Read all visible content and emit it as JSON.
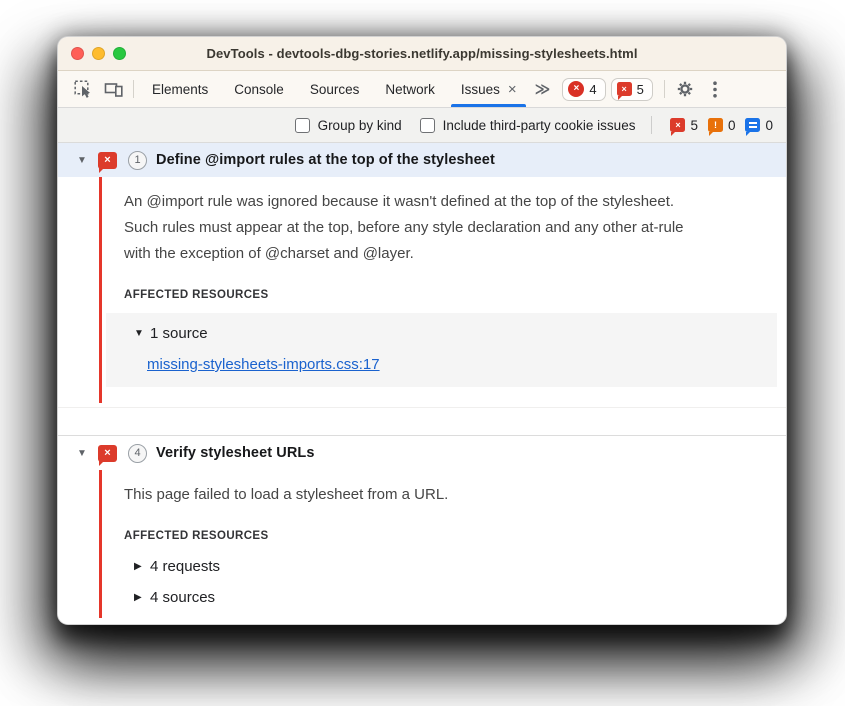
{
  "window": {
    "title": "DevTools - devtools-dbg-stories.netlify.app/missing-stylesheets.html"
  },
  "tabbar": {
    "tabs": [
      "Elements",
      "Console",
      "Sources",
      "Network"
    ],
    "issues_tab_label": "Issues",
    "error_count": "4",
    "issue_count": "5"
  },
  "filterbar": {
    "group_by_kind_label": "Group by kind",
    "third_party_label": "Include third-party cookie issues",
    "page_error_count": "5",
    "warning_count": "0",
    "info_count": "0"
  },
  "issues": [
    {
      "count": "1",
      "title": "Define @import rules at the top of the stylesheet",
      "description": "An @import rule was ignored because it wasn't defined at the top of the stylesheet. Such rules must appear at the top, before any style declaration and any other at-rule with the exception of @charset and @layer.",
      "affected_resources_label": "AFFECTED RESOURCES",
      "source_group_label": "1 source",
      "source_link": "missing-stylesheets-imports.css:17"
    },
    {
      "count": "4",
      "title": "Verify stylesheet URLs",
      "description": "This page failed to load a stylesheet from a URL.",
      "affected_resources_label": "AFFECTED RESOURCES",
      "requests_group_label": "4 requests",
      "sources_group_label": "4 sources"
    }
  ],
  "glyphs": {
    "close_tab": "×",
    "more_tabs": "≫",
    "expanded_triangle": "▼",
    "collapsed_triangle": "▶",
    "bubble_x": "×",
    "warning_mark": "!",
    "error_x": "×"
  },
  "colors": {
    "accent_blue": "#1a73e8",
    "error_red": "#d93025",
    "bubble_red": "#dc3b2b",
    "warning_orange": "#e8710a",
    "info_blue": "#1a73e8",
    "link_blue": "#1a62ce",
    "titlebar_cream": "#f7f1e8",
    "selected_issue_bg": "#e7eef9",
    "severity_line_red": "#e5362a"
  }
}
